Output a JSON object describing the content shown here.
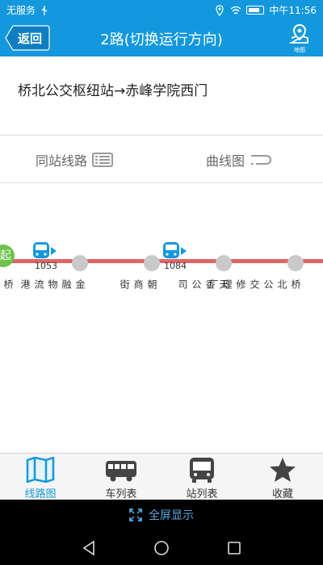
{
  "statusbar": {
    "carrier": "无服务",
    "time": "中午11:56"
  },
  "header": {
    "back_label": "返回",
    "title": "2路(切换运行方向)",
    "map_caption": "地图"
  },
  "route": {
    "name": "桥北公交枢纽站→赤峰学院西门"
  },
  "tabs": [
    {
      "label": "同站线路",
      "icon": "list-icon"
    },
    {
      "label": "曲线图",
      "icon": "curve-icon"
    }
  ],
  "route_map": {
    "start_label": "起",
    "line_color": "#e06464",
    "stations": [
      {
        "name": "桥北公交枢纽站"
      },
      {
        "name": "金融物流港"
      },
      {
        "name": "朝商街"
      },
      {
        "name": "天香公司"
      },
      {
        "name": "桥北公交修理厂"
      }
    ],
    "buses": [
      {
        "id": "1053"
      },
      {
        "id": "1084"
      }
    ]
  },
  "bottom_nav": [
    {
      "label": "线路图",
      "icon": "route-map-icon",
      "active": true
    },
    {
      "label": "车列表",
      "icon": "bus-list-icon",
      "active": false
    },
    {
      "label": "站列表",
      "icon": "station-list-icon",
      "active": false
    },
    {
      "label": "收藏",
      "icon": "star-icon",
      "active": false
    }
  ],
  "fullscreen": {
    "label": "全屏显示"
  },
  "colors": {
    "primary": "#1398dd",
    "start_green": "#6cc24a",
    "line_red": "#e06464"
  }
}
